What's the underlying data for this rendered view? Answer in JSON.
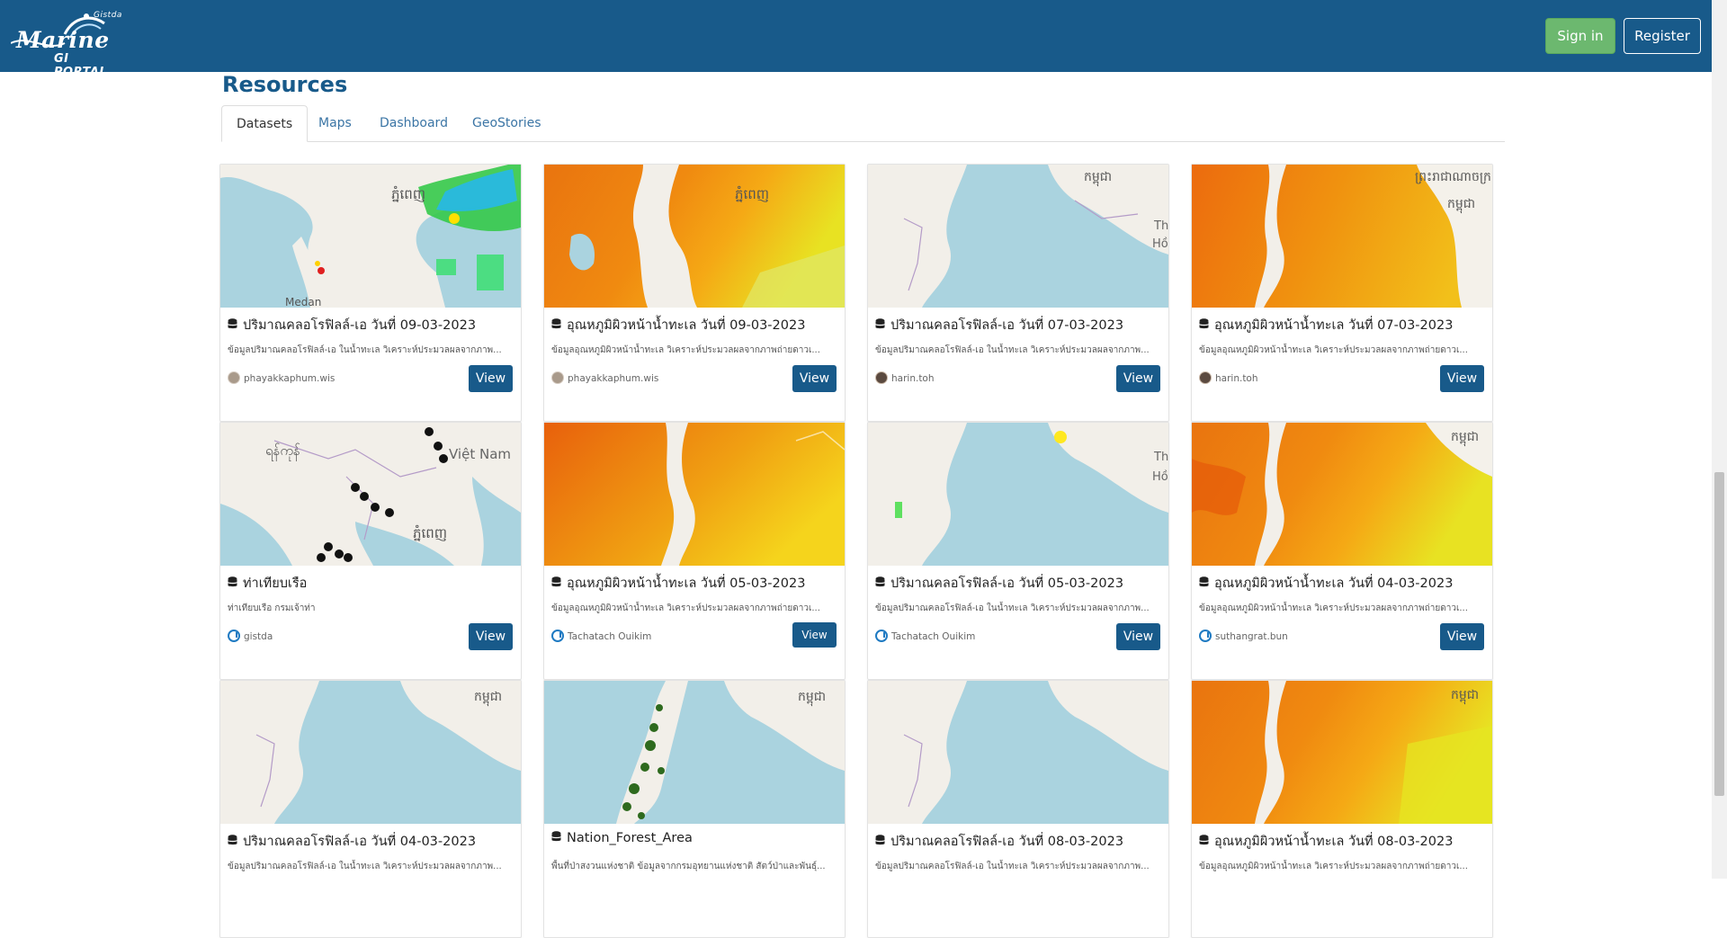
{
  "header": {
    "logo_main": "Marine",
    "logo_sub": "GI PORTAL",
    "logo_org": "Gistda",
    "signin_label": "Sign in",
    "register_label": "Register",
    "colors": {
      "bar": "#185a8a",
      "signin": "#6cb86f",
      "view_button": "#185a8a"
    }
  },
  "resources": {
    "title": "Resources",
    "tabs": [
      {
        "label": "Datasets",
        "active": true
      },
      {
        "label": "Maps",
        "active": false
      },
      {
        "label": "Dashboard",
        "active": false
      },
      {
        "label": "GeoStories",
        "active": false
      }
    ]
  },
  "cards": [
    {
      "title": "ปริมาณคลอโรฟิลล์-เอ วันที่ 09-03-2023",
      "desc": "ข้อมูลปริมาณคลอโรฟิลล์-เอ ในน้ำทะเล วิเคราะห์ประมวลผลจากภาพ...",
      "author": "phayakkaphum.wis",
      "view": "View",
      "icon": "database-icon",
      "avatar": "photo"
    },
    {
      "title": "อุณหภูมิผิวหน้าน้ำทะเล วันที่ 09-03-2023",
      "desc": "ข้อมูลอุณหภูมิผิวหน้าน้ำทะเล วิเคราะห์ประมวลผลจากภาพถ่ายดาวเ...",
      "author": "phayakkaphum.wis",
      "view": "View",
      "icon": "database-icon",
      "avatar": "photo"
    },
    {
      "title": "ปริมาณคลอโรฟิลล์-เอ วันที่ 07-03-2023",
      "desc": "ข้อมูลปริมาณคลอโรฟิลล์-เอ ในน้ำทะเล วิเคราะห์ประมวลผลจากภาพ...",
      "author": "harin.toh",
      "view": "View",
      "icon": "database-icon",
      "avatar": "dark"
    },
    {
      "title": "อุณหภูมิผิวหน้าน้ำทะเล วันที่ 07-03-2023",
      "desc": "ข้อมูลอุณหภูมิผิวหน้าน้ำทะเล วิเคราะห์ประมวลผลจากภาพถ่ายดาวเ...",
      "author": "harin.toh",
      "view": "View",
      "icon": "database-icon",
      "avatar": "dark"
    },
    {
      "title": "ท่าเทียบเรือ",
      "desc": "ท่าเทียบเรือ กรมเจ้าท่า",
      "author": "gistda",
      "view": "View",
      "icon": "database-icon",
      "avatar": "ring"
    },
    {
      "title": "อุณหภูมิผิวหน้าน้ำทะเล วันที่ 05-03-2023",
      "desc": "ข้อมูลอุณหภูมิผิวหน้าน้ำทะเล วิเคราะห์ประมวลผลจากภาพถ่ายดาวเ...",
      "author": "Tachatach Ouikim",
      "view": "View",
      "icon": "database-icon",
      "avatar": "ring"
    },
    {
      "title": "ปริมาณคลอโรฟิลล์-เอ วันที่ 05-03-2023",
      "desc": "ข้อมูลปริมาณคลอโรฟิลล์-เอ ในน้ำทะเล วิเคราะห์ประมวลผลจากภาพ...",
      "author": "Tachatach Ouikim",
      "view": "View",
      "icon": "database-icon",
      "avatar": "ring"
    },
    {
      "title": "อุณหภูมิผิวหน้าน้ำทะเล วันที่ 04-03-2023",
      "desc": "ข้อมูลอุณหภูมิผิวหน้าน้ำทะเล วิเคราะห์ประมวลผลจากภาพถ่ายดาวเ...",
      "author": "suthangrat.bun",
      "view": "View",
      "icon": "database-icon",
      "avatar": "ring"
    },
    {
      "title": "ปริมาณคลอโรฟิลล์-เอ วันที่ 04-03-2023",
      "desc": "ข้อมูลปริมาณคลอโรฟิลล์-เอ ในน้ำทะเล วิเคราะห์ประมวลผลจากภาพ...",
      "author": "",
      "view": "View",
      "icon": "database-icon",
      "avatar": ""
    },
    {
      "title": "Nation_Forest_Area",
      "desc": "พื้นที่ป่าสงวนแห่งชาติ ข้อมูลจากกรมอุทยานแห่งชาติ สัตว์ป่าและพันธุ์...",
      "author": "",
      "view": "View",
      "icon": "database-icon",
      "avatar": ""
    },
    {
      "title": "ปริมาณคลอโรฟิลล์-เอ วันที่ 08-03-2023",
      "desc": "ข้อมูลปริมาณคลอโรฟิลล์-เอ ในน้ำทะเล วิเคราะห์ประมวลผลจากภาพ...",
      "author": "",
      "view": "View",
      "icon": "database-icon",
      "avatar": ""
    },
    {
      "title": "อุณหภูมิผิวหน้าน้ำทะเล วันที่ 08-03-2023",
      "desc": "ข้อมูลอุณหภูมิผิวหน้าน้ำทะเล วิเคราะห์ประมวลผลจากภาพถ่ายดาวเ...",
      "author": "",
      "view": "View",
      "icon": "database-icon",
      "avatar": ""
    }
  ],
  "map_labels": {
    "phnom_penh": "ភ្នំពេញ",
    "cambodia": "កម្ពុជា",
    "kingdom_of_cambodia": "ព្រះរាជាណាចក្រ",
    "medan": "Medan",
    "myanmar": "ရန်ကုန်",
    "viet_nam": "Việt Nam",
    "thai_fragment": "Th",
    "ho_fragment": "Hồ"
  }
}
